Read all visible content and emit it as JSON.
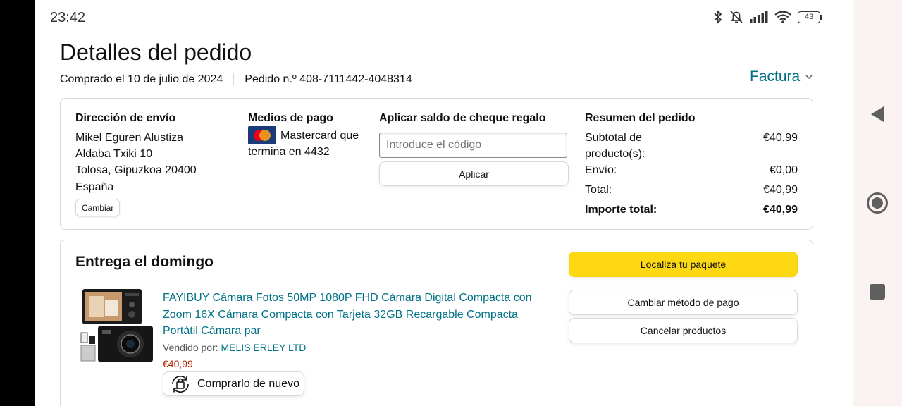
{
  "status_bar": {
    "time": "23:42",
    "battery_level": "43"
  },
  "header": {
    "title": "Detalles del pedido",
    "purchase_date": "Comprado el 10 de julio de 2024",
    "order_number": "Pedido n.º 408-7111442-4048314",
    "invoice_label": "Factura"
  },
  "shipping": {
    "title": "Dirección de envío",
    "lines": [
      "Mikel Eguren Alustiza",
      "Aldaba Txiki 10",
      "Tolosa, Gipuzkoa 20400",
      "España"
    ],
    "change_label": "Cambiar"
  },
  "payment": {
    "title": "Medios de pago",
    "method_text": "Mastercard que termina en 4432",
    "card_icon": "mastercard-icon"
  },
  "gift_card": {
    "title": "Aplicar saldo de cheque regalo",
    "placeholder": "Introduce el código",
    "apply_label": "Aplicar"
  },
  "summary": {
    "title": "Resumen del pedido",
    "rows": [
      {
        "label": "Subtotal de producto(s):",
        "value": "€40,99"
      },
      {
        "label": "Envío:",
        "value": "€0,00"
      },
      {
        "label": "Total:",
        "value": "€40,99"
      },
      {
        "label": "Importe total:",
        "value": "€40,99"
      }
    ]
  },
  "delivery": {
    "title": "Entrega el domingo",
    "product": {
      "title": "FAYIBUY Cámara Fotos 50MP 1080P FHD Cámara Digital Compacta con Zoom 16X Cámara Compacta con Tarjeta 32GB Recargable Compacta Portátil Cámara par",
      "seller_prefix": "Vendido por:",
      "seller_name": "MELIS ERLEY LTD",
      "price": "€40,99",
      "rebuy_label": "Comprarlo de nuevo"
    },
    "actions": {
      "track": "Localiza tu paquete",
      "change_payment": "Cambiar método de pago",
      "cancel": "Cancelar productos"
    }
  },
  "colors": {
    "link": "#007185",
    "price": "#b12704",
    "primary_button": "#ffd814",
    "border": "#d5d9d9"
  }
}
